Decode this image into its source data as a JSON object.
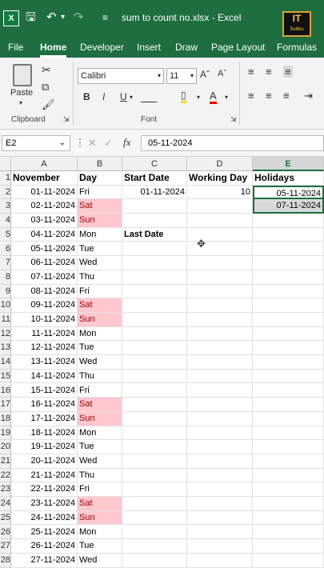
{
  "app": {
    "title": "sum to count no.xlsx  -  Excel",
    "logo_text": "IT",
    "logo_sub": "Subbu"
  },
  "tabs": [
    "File",
    "Home",
    "Developer",
    "Insert",
    "Draw",
    "Page Layout",
    "Formulas"
  ],
  "ribbon": {
    "paste_label": "Paste",
    "clipboard_label": "Clipboard",
    "font_label": "Font",
    "font_name": "Calibri",
    "font_size": "11",
    "format_buttons": [
      "B",
      "I",
      "U"
    ]
  },
  "formula_bar": {
    "name_box": "E2",
    "value": "05-11-2024",
    "fx": "fx"
  },
  "columns": [
    "A",
    "B",
    "C",
    "D",
    "E"
  ],
  "selected_column": "E",
  "rows": [
    [
      "November",
      "Day",
      "Start Date",
      "Working Day",
      "Holidays"
    ],
    [
      "01-11-2024",
      "Fri",
      "01-11-2024",
      "10",
      "05-11-2024"
    ],
    [
      "02-11-2024",
      "Sat",
      "",
      "",
      "07-11-2024"
    ],
    [
      "03-11-2024",
      "Sun",
      "",
      "",
      ""
    ],
    [
      "04-11-2024",
      "Mon",
      "Last Date",
      "",
      ""
    ],
    [
      "05-11-2024",
      "Tue",
      "",
      "",
      ""
    ],
    [
      "06-11-2024",
      "Wed",
      "",
      "",
      ""
    ],
    [
      "07-11-2024",
      "Thu",
      "",
      "",
      ""
    ],
    [
      "08-11-2024",
      "Fri",
      "",
      "",
      ""
    ],
    [
      "09-11-2024",
      "Sat",
      "",
      "",
      ""
    ],
    [
      "10-11-2024",
      "Sun",
      "",
      "",
      ""
    ],
    [
      "11-11-2024",
      "Mon",
      "",
      "",
      ""
    ],
    [
      "12-11-2024",
      "Tue",
      "",
      "",
      ""
    ],
    [
      "13-11-2024",
      "Wed",
      "",
      "",
      ""
    ],
    [
      "14-11-2024",
      "Thu",
      "",
      "",
      ""
    ],
    [
      "15-11-2024",
      "Fri",
      "",
      "",
      ""
    ],
    [
      "16-11-2024",
      "Sat",
      "",
      "",
      ""
    ],
    [
      "17-11-2024",
      "Sun",
      "",
      "",
      ""
    ],
    [
      "18-11-2024",
      "Mon",
      "",
      "",
      ""
    ],
    [
      "19-11-2024",
      "Tue",
      "",
      "",
      ""
    ],
    [
      "20-11-2024",
      "Wed",
      "",
      "",
      ""
    ],
    [
      "21-11-2024",
      "Thu",
      "",
      "",
      ""
    ],
    [
      "22-11-2024",
      "Fri",
      "",
      "",
      ""
    ],
    [
      "23-11-2024",
      "Sat",
      "",
      "",
      ""
    ],
    [
      "24-11-2024",
      "Sun",
      "",
      "",
      ""
    ],
    [
      "25-11-2024",
      "Mon",
      "",
      "",
      ""
    ],
    [
      "26-11-2024",
      "Tue",
      "",
      "",
      ""
    ],
    [
      "27-11-2024",
      "Wed",
      "",
      "",
      ""
    ]
  ],
  "row_numbers": [
    "1",
    "2",
    "3",
    "4",
    "5",
    "6",
    "7",
    "8",
    "9",
    "10",
    "11",
    "12",
    "13",
    "14",
    "15",
    "16",
    "17",
    "18",
    "19",
    "20",
    "21",
    "22",
    "23",
    "24",
    "25",
    "26",
    "27",
    "28"
  ],
  "colors": {
    "excel_green": "#1e6e3f",
    "weekend_fill": "#ffc7ce",
    "weekend_text": "#9c0006"
  }
}
